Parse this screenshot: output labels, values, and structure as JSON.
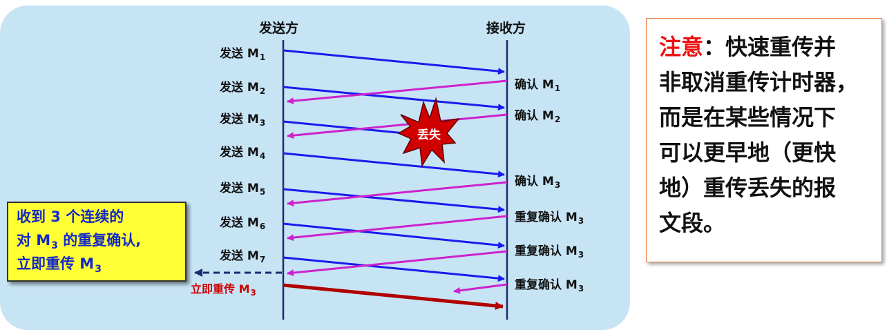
{
  "sender_title": "发送方",
  "receiver_title": "接收方",
  "send_prefix": "发送 M",
  "sends": [
    "1",
    "2",
    "3",
    "4",
    "5",
    "6",
    "7"
  ],
  "acks": [
    {
      "prefix": "确认 M",
      "sub": "1"
    },
    {
      "prefix": "确认 M",
      "sub": "2"
    },
    {
      "prefix": "确认 M",
      "sub": "3"
    },
    {
      "prefix": "重复确认 M",
      "sub": "3"
    },
    {
      "prefix": "重复确认 M",
      "sub": "3"
    },
    {
      "prefix": "重复确认 M",
      "sub": "3"
    }
  ],
  "lost_label": "丢失",
  "retransmit": {
    "prefix": "立即重传 M",
    "sub": "3"
  },
  "callout": {
    "line1": "收到 3 个连续的",
    "line2_prefix": "对 M",
    "line2_sub": "3",
    "line2_suffix": " 的重复确认,",
    "line3_prefix": "立即重传 M",
    "line3_sub": "3"
  },
  "note": {
    "head": "注意",
    "line1_rest": "：快速重传并",
    "line2": "非取消重传计时器，",
    "line3": "而是在某些情况下",
    "line4": "可以更早地（更快",
    "line5": "地）重传丢失的报",
    "line6": "文段。"
  },
  "colors": {
    "panel": "#c7e4f5",
    "data_arrow": "#1a1aee",
    "ack_arrow": "#cc22cc",
    "retransmit_arrow": "#b00000",
    "callout_bg": "#ffff33",
    "callout_text": "#1428c8",
    "note_head": "#ee1111"
  }
}
